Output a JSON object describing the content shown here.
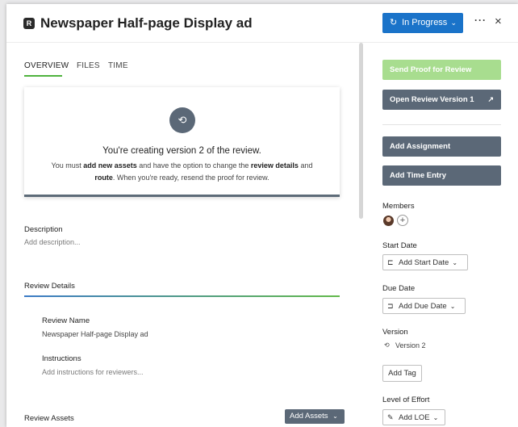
{
  "header": {
    "logo_glyph": "R",
    "title": "Newspaper Half-page Display ad",
    "status": {
      "icon": "progress-icon",
      "label": "In Progress"
    },
    "more_label": "···",
    "close_label": "×"
  },
  "tabs": [
    {
      "label": "OVERVIEW",
      "active": true
    },
    {
      "label": "FILES",
      "active": false
    },
    {
      "label": "TIME",
      "active": false
    }
  ],
  "notice": {
    "icon": "sync-icon",
    "heading": "You're creating version 2 of the review.",
    "body_1": "You must ",
    "body_bold_1": "add new assets",
    "body_2": " and have the option to change the ",
    "body_bold_2": "review details",
    "body_3": " and ",
    "body_bold_3": "route",
    "body_4": ". When you're ready, resend the proof for review."
  },
  "description": {
    "label": "Description",
    "placeholder": "Add description..."
  },
  "review_details": {
    "heading": "Review Details",
    "name_label": "Review Name",
    "name_value": "Newspaper Half-page Display ad",
    "instructions_label": "Instructions",
    "instructions_placeholder": "Add instructions for reviewers..."
  },
  "review_assets": {
    "heading": "Review Assets",
    "add_button": "Add Assets"
  },
  "sidebar": {
    "send_proof": "Send Proof for Review",
    "open_review": "Open Review Version 1",
    "add_assignment": "Add Assignment",
    "add_time_entry": "Add Time Entry",
    "members_label": "Members",
    "start_date_label": "Start Date",
    "start_date_button": "Add Start Date",
    "due_date_label": "Due Date",
    "due_date_button": "Add Due Date",
    "version_label": "Version",
    "version_value": "Version 2",
    "add_tag": "Add Tag",
    "loe_label": "Level of Effort",
    "loe_button": "Add LOE"
  },
  "colors": {
    "primary": "#1a73c9",
    "accent_green": "#4fb33d",
    "disabled_green": "#a8dd8f",
    "slate": "#5b6877"
  }
}
